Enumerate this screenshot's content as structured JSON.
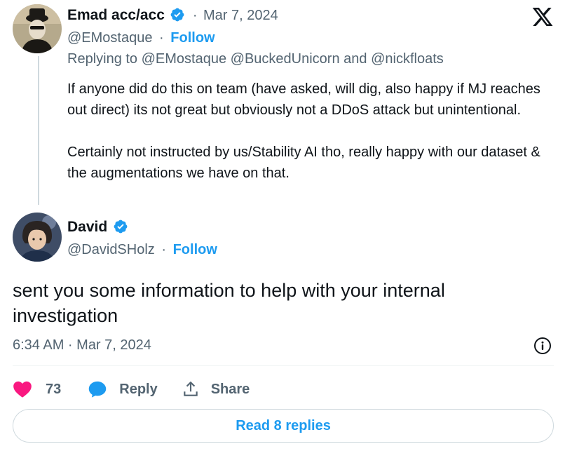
{
  "reply_tweet": {
    "author_name": "Emad acc/acc",
    "date": "Mar 7, 2024",
    "handle": "@EMostaque",
    "follow_label": "Follow",
    "replying_prefix": "Replying to",
    "replying_to": "@EMostaque @BuckedUnicorn",
    "replying_and": "and",
    "replying_last": "@nickfloats",
    "paragraph_1": "If anyone did do this on team (have asked, will dig, also happy if MJ reaches out direct) its not great but obviously not a DDoS attack but unintentional.",
    "paragraph_2": "Certainly not instructed by us/Stability AI tho, really happy with our dataset & the augmentations we have on that."
  },
  "main_tweet": {
    "author_name": "David",
    "handle": "@DavidSHolz",
    "follow_label": "Follow",
    "text": "sent you some information to help with your internal investigation",
    "timestamp": "6:34 AM · Mar 7, 2024",
    "like_count": "73",
    "reply_label": "Reply",
    "share_label": "Share",
    "read_replies_label": "Read 8 replies"
  },
  "separator": "·",
  "icons": {
    "verified": "verified-badge-icon",
    "logo": "x-logo-icon",
    "info": "info-icon",
    "like": "heart-icon",
    "reply": "speech-bubble-icon",
    "share": "share-upload-icon"
  },
  "colors": {
    "accent": "#1d9bf0",
    "like": "#f91880",
    "text": "#0f1419",
    "muted": "#536471",
    "border": "#cfd9de"
  }
}
